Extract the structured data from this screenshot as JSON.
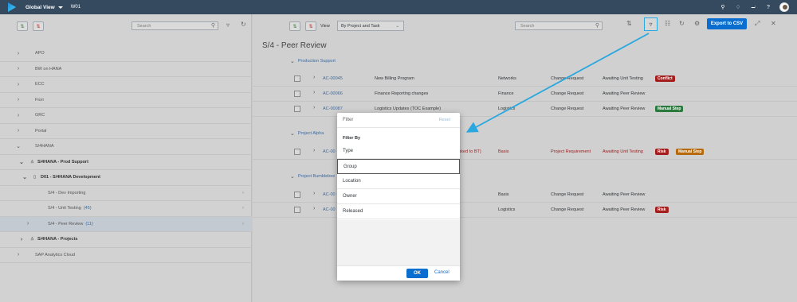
{
  "shell": {
    "title": "Global View",
    "subtitle": "W01"
  },
  "left": {
    "search_placeholder": "Search",
    "tree": [
      {
        "label": "APO"
      },
      {
        "label": "BW on HANA"
      },
      {
        "label": "ECC"
      },
      {
        "label": "Fiori"
      },
      {
        "label": "GRC"
      },
      {
        "label": "Portal"
      },
      {
        "label": "S/4HANA"
      },
      {
        "label": "S/4HANA - Prod Support"
      },
      {
        "label": "D01 - S/4HANA Development"
      },
      {
        "label": "S/4 - Dev Importing"
      },
      {
        "label": "S/4 - Unit Testing",
        "count": "(45)"
      },
      {
        "label": "S/4 - Peer Review",
        "count": "(11)"
      },
      {
        "label": "S/4HANA - Projects"
      },
      {
        "label": "SAP Analytics Cloud"
      }
    ]
  },
  "right": {
    "view_label": "View",
    "view_select": "By Project and Task",
    "search_placeholder": "Search",
    "export_label": "Export to CSV",
    "page_title": "S/4 - Peer Review",
    "groups": [
      {
        "label": "Production Support"
      },
      {
        "label": "Project Alpha"
      },
      {
        "label": "Project Bumblebee"
      }
    ],
    "rows": [
      {
        "id": "AC-00045",
        "title": "New Billing Program",
        "group": "Networks",
        "type": "Change Request",
        "status": "Awaiting Unit Testing",
        "badge": "Conflict"
      },
      {
        "id": "AC-00066",
        "title": "Finance Reporting changes",
        "group": "Finance",
        "type": "Change Request",
        "status": "Awaiting Peer Review",
        "badge": ""
      },
      {
        "id": "AC-00087",
        "title": "Logistics Updates (TOC Example)",
        "group": "Logistics",
        "type": "Change Request",
        "status": "Awaiting Peer Review",
        "badge": "Manual Step"
      },
      {
        "id": "AC-00",
        "title": "ts linked to BT)",
        "group": "Basis",
        "type": "Project Requirement",
        "status": "Awaiting Unit Testing",
        "badge": "Risk",
        "badge2": "Manual Step"
      },
      {
        "id": "AC-00",
        "title": "",
        "group": "Basis",
        "type": "Change Request",
        "status": "Awaiting Peer Review",
        "badge": ""
      },
      {
        "id": "AC-00",
        "title": "",
        "group": "Logistics",
        "type": "Change Request",
        "status": "Awaiting Peer Review",
        "badge": "Risk"
      }
    ]
  },
  "dialog": {
    "title": "Filter",
    "reset": "Reset",
    "filter_by": "Filter By",
    "options": [
      "Type",
      "Group",
      "Location",
      "Owner",
      "Released"
    ],
    "ok": "OK",
    "cancel": "Cancel"
  }
}
